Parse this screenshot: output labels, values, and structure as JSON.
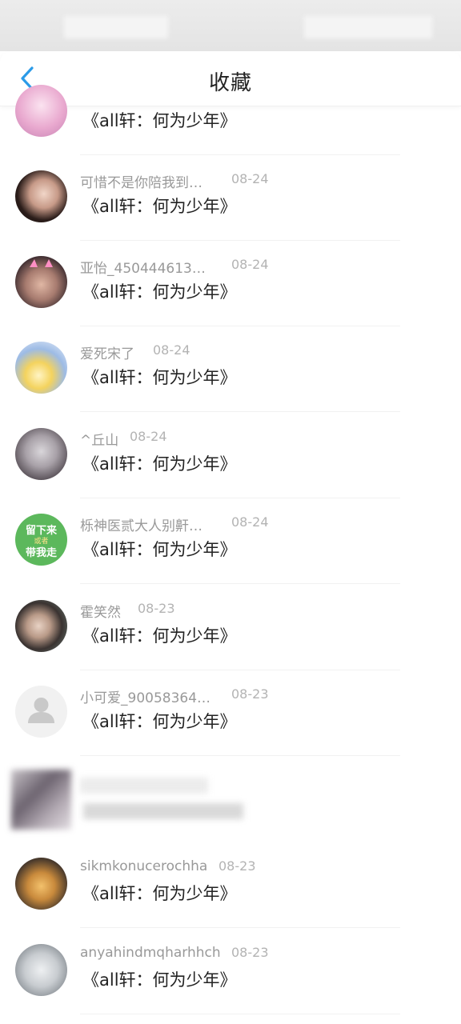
{
  "header": {
    "title": "收藏"
  },
  "rows": [
    {
      "name": "",
      "date": "",
      "message": "《all轩：何为少年》"
    },
    {
      "name": "可惜不是你陪我到…",
      "date": "08-24",
      "message": "《all轩：何为少年》"
    },
    {
      "name": "亚怡_450444613…",
      "date": "08-24",
      "message": "《all轩：何为少年》"
    },
    {
      "name": "爱死宋了",
      "date": "08-24",
      "message": "《all轩：何为少年》"
    },
    {
      "name": "^丘山",
      "date": "08-24",
      "message": "《all轩：何为少年》"
    },
    {
      "name": "栎神医贰大人别鼾…",
      "date": "08-24",
      "message": "《all轩：何为少年》",
      "avatar_text": [
        "留下来",
        "或者",
        "带我走"
      ]
    },
    {
      "name": "霍笑然",
      "date": "08-23",
      "message": "《all轩：何为少年》"
    },
    {
      "name": "小可爱_90058364…",
      "date": "08-23",
      "message": "《all轩：何为少年》"
    },
    {
      "name": "",
      "date": "",
      "message": ""
    },
    {
      "name": "sikmkonucerochha",
      "date": "08-23",
      "message": "《all轩：何为少年》"
    },
    {
      "name": "anyahindmqharhhch",
      "date": "08-23",
      "message": "《all轩：何为少年》"
    }
  ],
  "colors": {
    "accent": "#2b9be8",
    "green_avatar": "#5cb85c"
  }
}
